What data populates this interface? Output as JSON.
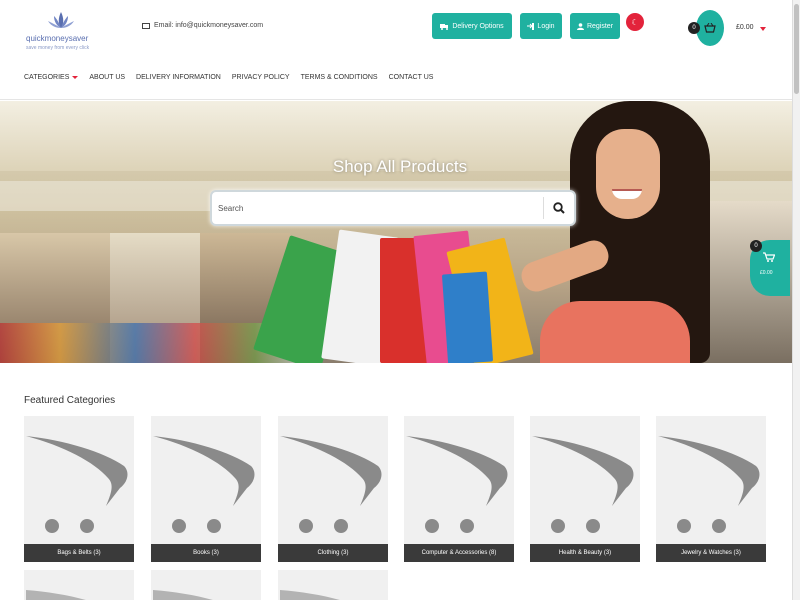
{
  "header": {
    "logo_name": "quickmoneysaver",
    "logo_tagline": "save money from every click",
    "email_text": "Email: info@quickmoneysaver.com",
    "delivery_label": "Delivery Options",
    "login_label": "Login",
    "register_label": "Register",
    "language_flag": "☾",
    "cart_count": "0",
    "cart_total": "£0.00"
  },
  "nav": {
    "items": [
      "CATEGORIES",
      "ABOUT US",
      "DELIVERY INFORMATION",
      "PRIVACY POLICY",
      "TERMS & CONDITIONS",
      "CONTACT US"
    ]
  },
  "hero": {
    "title": "Shop All Products",
    "search_placeholder": "Search"
  },
  "floating_cart": {
    "count": "0",
    "total": "£0.00"
  },
  "featured": {
    "title": "Featured Categories",
    "categories": [
      "Bags & Belts (3)",
      "Books (3)",
      "Clothing (3)",
      "Computer & Accessories (8)",
      "Health & Beauty (3)",
      "Jewelry & Watches (3)"
    ]
  },
  "colors": {
    "accent": "#1fb1a0",
    "red": "#e3233b",
    "label_bg": "#3a3a3a"
  }
}
